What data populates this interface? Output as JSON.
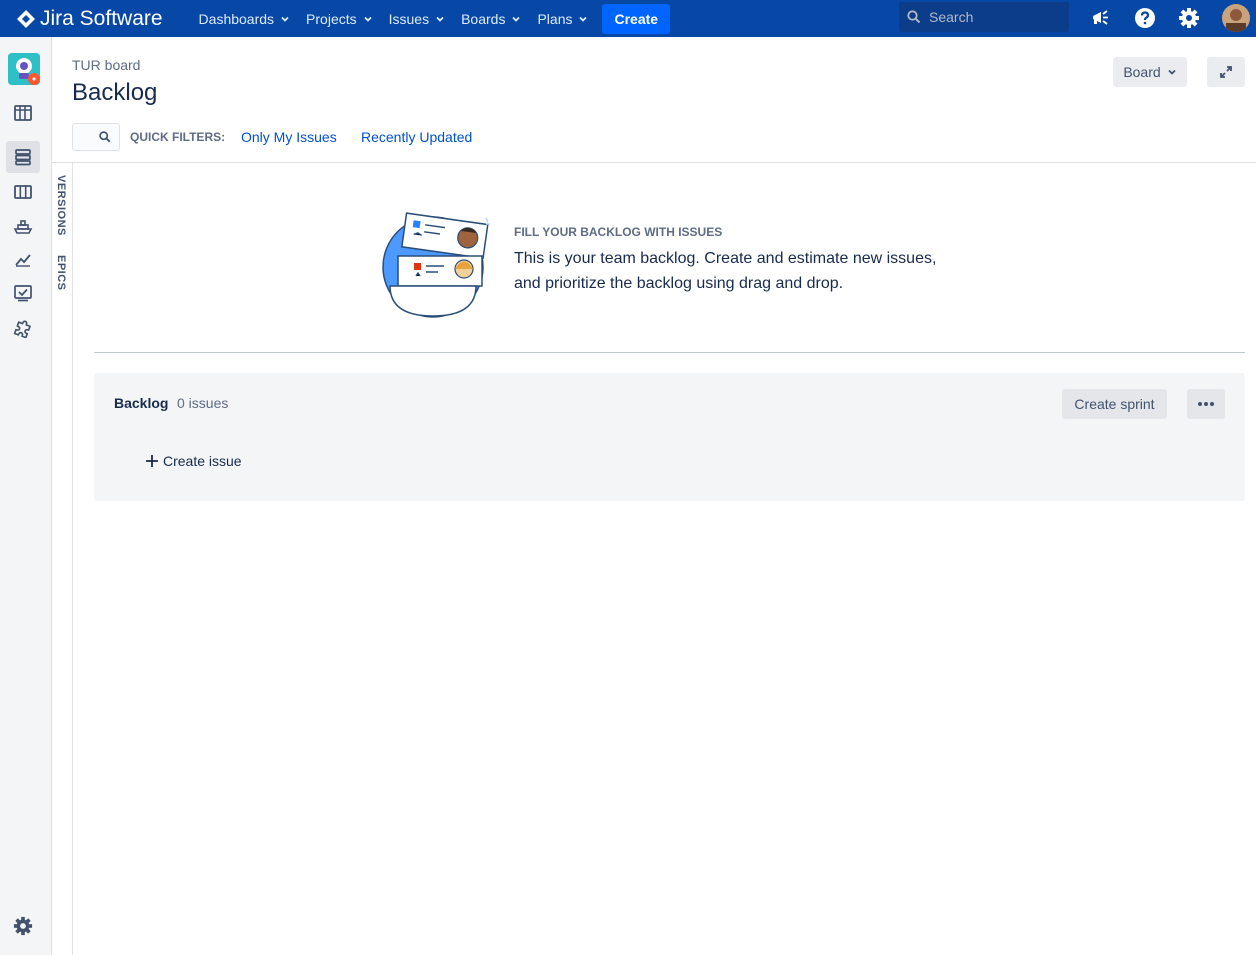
{
  "topnav": {
    "brand": "Jira Software",
    "items": [
      {
        "label": "Dashboards"
      },
      {
        "label": "Projects"
      },
      {
        "label": "Issues"
      },
      {
        "label": "Boards"
      },
      {
        "label": "Plans"
      }
    ],
    "create_label": "Create",
    "search_placeholder": "Search",
    "icons": [
      "notifications-megaphone-icon",
      "help-icon",
      "settings-gear-icon",
      "user-avatar"
    ]
  },
  "sidebar": {
    "icons": [
      "project-avatar",
      "roadmap-icon",
      "backlog-icon",
      "board-icon",
      "releases-icon",
      "reports-icon",
      "issues-icon",
      "add-ons-icon",
      "project-settings-icon"
    ],
    "active": "backlog-icon"
  },
  "side_panels": {
    "versions": "VERSIONS",
    "epics": "EPICS"
  },
  "header": {
    "breadcrumb": "TUR board",
    "title": "Backlog",
    "board_button": "Board"
  },
  "quick_filters": {
    "label": "QUICK FILTERS:",
    "items": [
      "Only My Issues",
      "Recently Updated"
    ]
  },
  "empty_state": {
    "heading": "FILL YOUR BACKLOG WITH ISSUES",
    "line1": "This is your team backlog. Create and estimate new issues,",
    "line2": "and prioritize the backlog using drag and drop."
  },
  "backlog": {
    "title": "Backlog",
    "count": "0 issues",
    "create_sprint": "Create sprint",
    "create_issue": "Create issue"
  },
  "colors": {
    "nav_bg": "#0747a6",
    "create_bg": "#0065ff",
    "link": "#0052cc",
    "panel_bg": "#f4f5f7"
  }
}
